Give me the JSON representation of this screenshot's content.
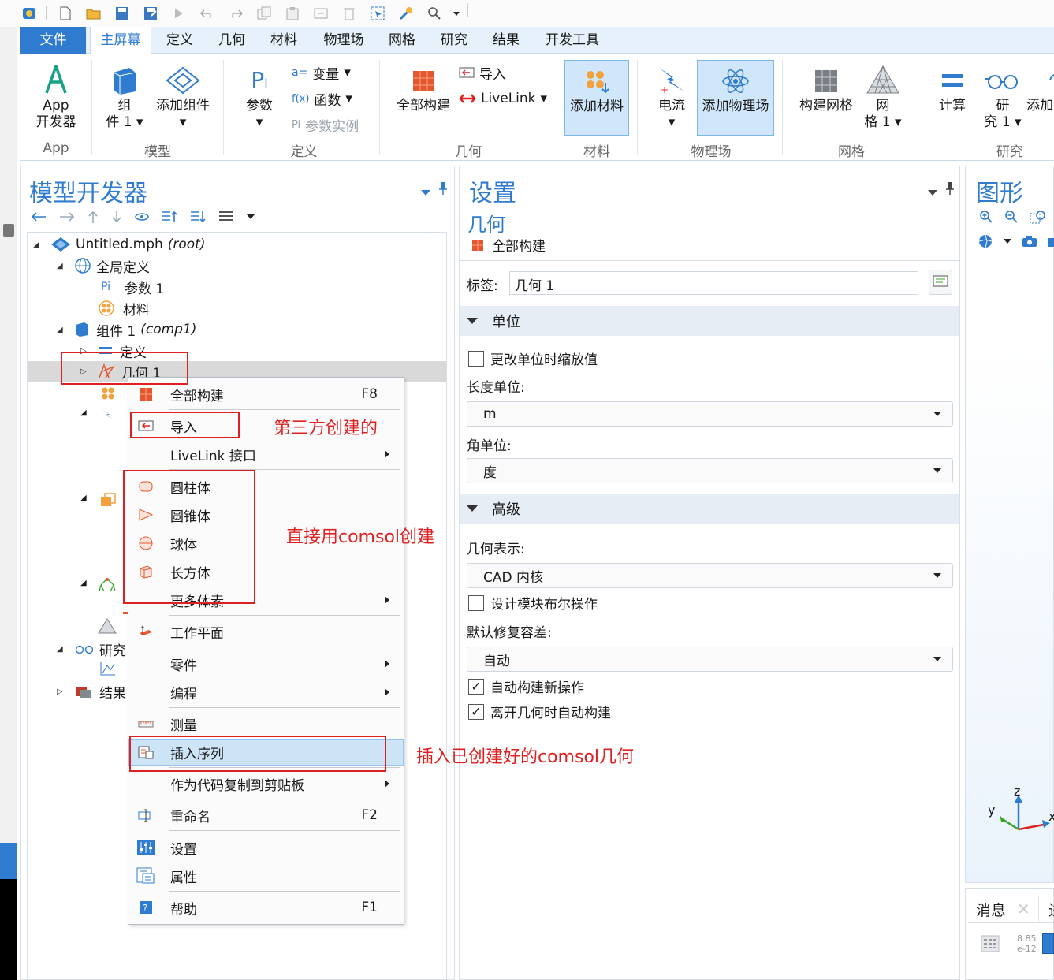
{
  "ribbon": {
    "tabs": [
      "文件",
      "主屏幕",
      "定义",
      "几何",
      "材料",
      "物理场",
      "网格",
      "研究",
      "结果",
      "开发工具"
    ],
    "app_builder_line1": "App",
    "app_builder_line2": "开发器",
    "component_line1": "组",
    "component_line2": "件 1",
    "add_component": "添加组件",
    "parameters": "参数",
    "variables": "变量",
    "functions": "函数",
    "parameter_case": "参数实例",
    "build_all": "全部构建",
    "import": "导入",
    "livelink": "LiveLink",
    "add_material": "添加材料",
    "electric_currents": "电流",
    "add_physics": "添加物理场",
    "build_mesh": "构建网格",
    "mesh_line1": "网",
    "mesh_line2": "格 1",
    "compute": "计算",
    "study_line1": "研",
    "study_line2": "究 1",
    "add_study": "添加",
    "groups": {
      "app": "App",
      "model": "模型",
      "definitions": "定义",
      "geometry": "几何",
      "materials": "材料",
      "physics": "物理场",
      "mesh": "网格",
      "study": "研究"
    }
  },
  "model_builder": {
    "title": "模型开发器",
    "tree": {
      "root_name": "Untitled.mph",
      "root_tag": "(root)",
      "global_definitions": "全局定义",
      "parameters": "参数 1",
      "materials": "材料",
      "component": "组件 1",
      "component_tag": "(comp1)",
      "definitions": "定义",
      "geometry": "几何 1",
      "study": "研究",
      "results": "结果"
    }
  },
  "settings": {
    "title": "设置",
    "subtitle": "几何",
    "build_all": "全部构建",
    "label_caption": "标签:",
    "label_value": "几何 1",
    "units_section": "单位",
    "scale_on_change": "更改单位时缩放值",
    "length_unit_label": "长度单位:",
    "length_unit_value": "m",
    "angular_unit_label": "角单位:",
    "angular_unit_value": "度",
    "advanced_section": "高级",
    "geometry_repr_label": "几何表示:",
    "geometry_repr_value": "CAD 内核",
    "design_boolean": "设计模块布尔操作",
    "repair_tol_label": "默认修复容差:",
    "repair_tol_value": "自动",
    "auto_build_new": "自动构建新操作",
    "auto_build_leave": "离开几何时自动构建"
  },
  "graphics": {
    "title": "图形",
    "axis_z": "z",
    "axis_y": "y",
    "axis_x": "x",
    "colors": {
      "x_axis": "#e02020",
      "y_axis": "#3aa52a",
      "z_axis": "#2e7bcf"
    }
  },
  "messages": {
    "tab_label": "消息",
    "tab_label_2": "进",
    "value_top": "8.85",
    "value_bottom": "e-12"
  },
  "context_menu": {
    "items": [
      {
        "label": "全部构建",
        "key": "F8"
      },
      {
        "label": "导入"
      },
      {
        "label": "LiveLink 接口"
      },
      {
        "label": "圆柱体"
      },
      {
        "label": "圆锥体"
      },
      {
        "label": "球体"
      },
      {
        "label": "长方体"
      },
      {
        "label": "更多体素"
      },
      {
        "label": "工作平面"
      },
      {
        "label": "零件"
      },
      {
        "label": "编程"
      },
      {
        "label": "测量"
      },
      {
        "label": "插入序列"
      },
      {
        "label": "作为代码复制到剪贴板"
      },
      {
        "label": "重命名",
        "key": "F2"
      },
      {
        "label": "设置"
      },
      {
        "label": "属性"
      },
      {
        "label": "帮助",
        "key": "F1"
      }
    ]
  },
  "annotations": {
    "third_party": "第三方创建的",
    "direct_comsol": "直接用comsol创建",
    "insert_sequence": "插入已创建好的comsol几何"
  },
  "colors": {
    "accent": "#2e7bcf",
    "highlight": "#cfe6fb",
    "annotation": "#e02020"
  }
}
